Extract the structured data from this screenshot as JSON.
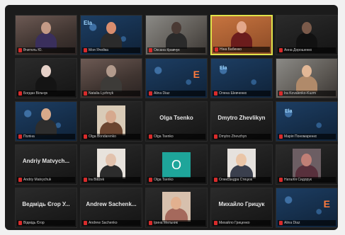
{
  "participants": [
    {
      "name": "Вчитель Ю.",
      "scene": "room",
      "kind": "person",
      "skin": "#c49a86",
      "shirt": "#3a2f5c"
    },
    {
      "name": "Моя Ячейка",
      "scene": "blueposter",
      "kind": "person",
      "skin": "#d98d6e",
      "shirt": "#2b2b2b",
      "slide_title": "Ela"
    },
    {
      "name": "Оксана Кравчук",
      "scene": "room2",
      "kind": "person",
      "skin": "#4a3a34",
      "shirt": "#2a2a2a"
    },
    {
      "name": "Ніна Бабенко",
      "scene": "orange",
      "kind": "person",
      "skin": "#e3a789",
      "shirt": "#6b1c1c",
      "active": true
    },
    {
      "name": "Анна Дорошенко",
      "scene": "dark",
      "kind": "person",
      "skin": "#7a5a4a",
      "shirt": "#111111"
    },
    {
      "name": "Богдан Вільчук",
      "scene": "dark",
      "kind": "person",
      "skin": "#e6d1c8",
      "shirt": "#141414"
    },
    {
      "name": "Natalia Lyzhnyk",
      "scene": "room",
      "kind": "person",
      "skin": "#b29a8c",
      "shirt": "#3d3b38"
    },
    {
      "name": "Alina Diaz",
      "scene": "blueposter",
      "kind": "slide",
      "slide_title": "",
      "logo": "E"
    },
    {
      "name": "Олена Шевченко",
      "scene": "blueposter",
      "kind": "slide",
      "slide_title": "Ela",
      "logo": ""
    },
    {
      "name": "Ira Kovalenko-Kuzm",
      "scene": "room2",
      "kind": "person",
      "skin": "#e2b796",
      "shirt": "#b08a6a"
    },
    {
      "name": "Поліна",
      "scene": "blueposter",
      "kind": "person",
      "skin": "#d7a98a",
      "shirt": "#2d2d2d"
    },
    {
      "name": "Olga Bondarenko",
      "scene": "dark",
      "kind": "photo",
      "skin": "#d6a98e",
      "shirt": "#6a4530",
      "bg": "#d9cbb7"
    },
    {
      "name": "Olga Tsenko",
      "scene": "dark",
      "kind": "name",
      "label": "Olga Tsenko"
    },
    {
      "name": "Dmytro Zhevzhyn",
      "scene": "dark",
      "kind": "name",
      "label": "Dmytro Zhevlikyn"
    },
    {
      "name": "Марія Пономаренко",
      "scene": "blueposter",
      "kind": "slide",
      "slide_title": "Ela",
      "logo": ""
    },
    {
      "name": "Andriy Matvychuk",
      "scene": "dark",
      "kind": "name",
      "label": "Andriy Matvych..."
    },
    {
      "name": "Ira Blazek",
      "scene": "dark",
      "kind": "photo",
      "skin": "#e2c2ad",
      "shirt": "#2c2c2c",
      "bg": "#e8e3dd"
    },
    {
      "name": "Olga Tsenko",
      "scene": "dark",
      "kind": "avatar",
      "letter": "O"
    },
    {
      "name": "Олександра Стецюк",
      "scene": "dark",
      "kind": "photo",
      "skin": "#eac5a7",
      "shirt": "#3a3f4d",
      "bg": "#e6e2de"
    },
    {
      "name": "Наталія Сидорук",
      "scene": "dark",
      "kind": "photo",
      "skin": "#c07f76",
      "shirt": "#58303c",
      "bg": "#6c5e63"
    },
    {
      "name": "Відмідь Єгор",
      "scene": "dark",
      "kind": "name",
      "label": "Ведмідь Єгор У..."
    },
    {
      "name": "Andrew Sachenko",
      "scene": "dark",
      "kind": "name",
      "label": "Andrew Sachenk..."
    },
    {
      "name": "Ірина Мельник",
      "scene": "dark",
      "kind": "photo",
      "skin": "#e2b08f",
      "shirt": "#a5695c",
      "bg": "#d7c0ad"
    },
    {
      "name": "Михайло Гриценко",
      "scene": "dark",
      "kind": "name",
      "label": "Михайло Грицук"
    },
    {
      "name": "Alina Diaz",
      "scene": "blueposter",
      "kind": "slide",
      "slide_title": "",
      "logo": "E"
    }
  ]
}
